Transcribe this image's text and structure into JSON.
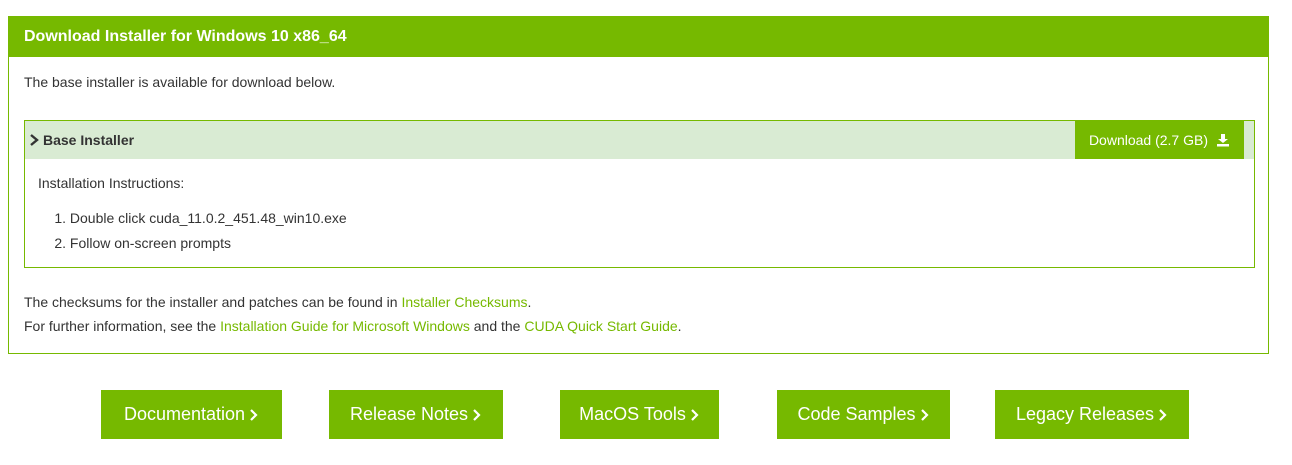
{
  "panel": {
    "title": "Download Installer for Windows 10 x86_64",
    "intro": "The base installer is available for download below."
  },
  "installer": {
    "title": "Base Installer",
    "download_label": "Download (2.7 GB)",
    "instructions_title": "Installation Instructions:",
    "steps": [
      {
        "num": "1.",
        "text": "Double click cuda_11.0.2_451.48_win10.exe"
      },
      {
        "num": "2.",
        "text": "Follow on-screen prompts"
      }
    ]
  },
  "notes": {
    "line1_prefix": "The checksums for the installer and patches can be found in ",
    "line1_link": "Installer Checksums",
    "line1_suffix": ".",
    "line2_prefix": "For further information, see the ",
    "line2_link1": "Installation Guide for Microsoft Windows",
    "line2_mid": " and the ",
    "line2_link2": "CUDA Quick Start Guide",
    "line2_suffix": "."
  },
  "buttons": [
    {
      "label": "Documentation"
    },
    {
      "label": "Release Notes"
    },
    {
      "label": "MacOS Tools"
    },
    {
      "label": "Code Samples"
    },
    {
      "label": "Legacy Releases"
    }
  ],
  "colors": {
    "accent": "#76b900",
    "installer_header_bg": "#d9ebd3"
  },
  "icons": {
    "chevron": "chevron-right-icon",
    "download": "download-icon",
    "arrow": "chevron-right-icon"
  }
}
